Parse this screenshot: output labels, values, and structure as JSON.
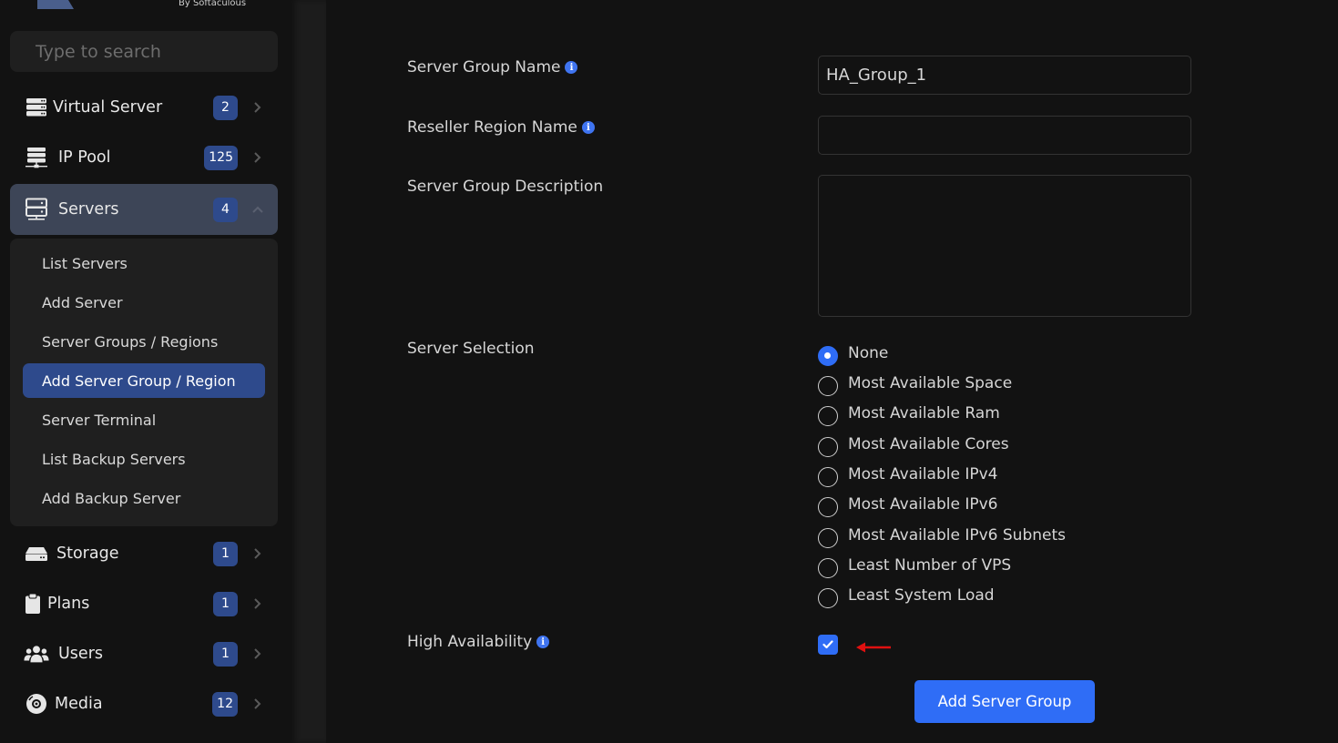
{
  "sidebar": {
    "logo_subtitle": "By Softaculous",
    "search": {
      "placeholder": "Type to search",
      "value": ""
    },
    "items": [
      {
        "label": "Virtual Server",
        "badge": "2",
        "icon": "server-stack-icon"
      },
      {
        "label": "IP Pool",
        "badge": "125",
        "icon": "network-server-icon"
      },
      {
        "label": "Servers",
        "badge": "4",
        "icon": "server-icon",
        "expanded": true
      },
      {
        "label": "Storage",
        "badge": "1",
        "icon": "hdd-icon"
      },
      {
        "label": "Plans",
        "badge": "1",
        "icon": "clipboard-icon"
      },
      {
        "label": "Users",
        "badge": "1",
        "icon": "users-icon"
      },
      {
        "label": "Media",
        "badge": "12",
        "icon": "disc-icon"
      }
    ],
    "servers_submenu": [
      {
        "label": "List Servers"
      },
      {
        "label": "Add Server"
      },
      {
        "label": "Server Groups / Regions"
      },
      {
        "label": "Add Server Group / Region",
        "active": true
      },
      {
        "label": "Server Terminal"
      },
      {
        "label": "List Backup Servers"
      },
      {
        "label": "Add Backup Server"
      }
    ]
  },
  "form": {
    "server_group_name": {
      "label": "Server Group Name",
      "value": "HA_Group_1"
    },
    "reseller_region_name": {
      "label": "Reseller Region Name",
      "value": ""
    },
    "server_group_description": {
      "label": "Server Group Description",
      "value": ""
    },
    "server_selection": {
      "label": "Server Selection",
      "selected": "None",
      "options": [
        "None",
        "Most Available Space",
        "Most Available Ram",
        "Most Available Cores",
        "Most Available IPv4",
        "Most Available IPv6",
        "Most Available IPv6 Subnets",
        "Least Number of VPS",
        "Least System Load"
      ]
    },
    "high_availability": {
      "label": "High Availability",
      "checked": true
    },
    "submit_label": "Add Server Group"
  },
  "colors": {
    "accent": "#2f6df6",
    "badge": "#2e4a8c",
    "annotation_arrow": "#e01010"
  }
}
